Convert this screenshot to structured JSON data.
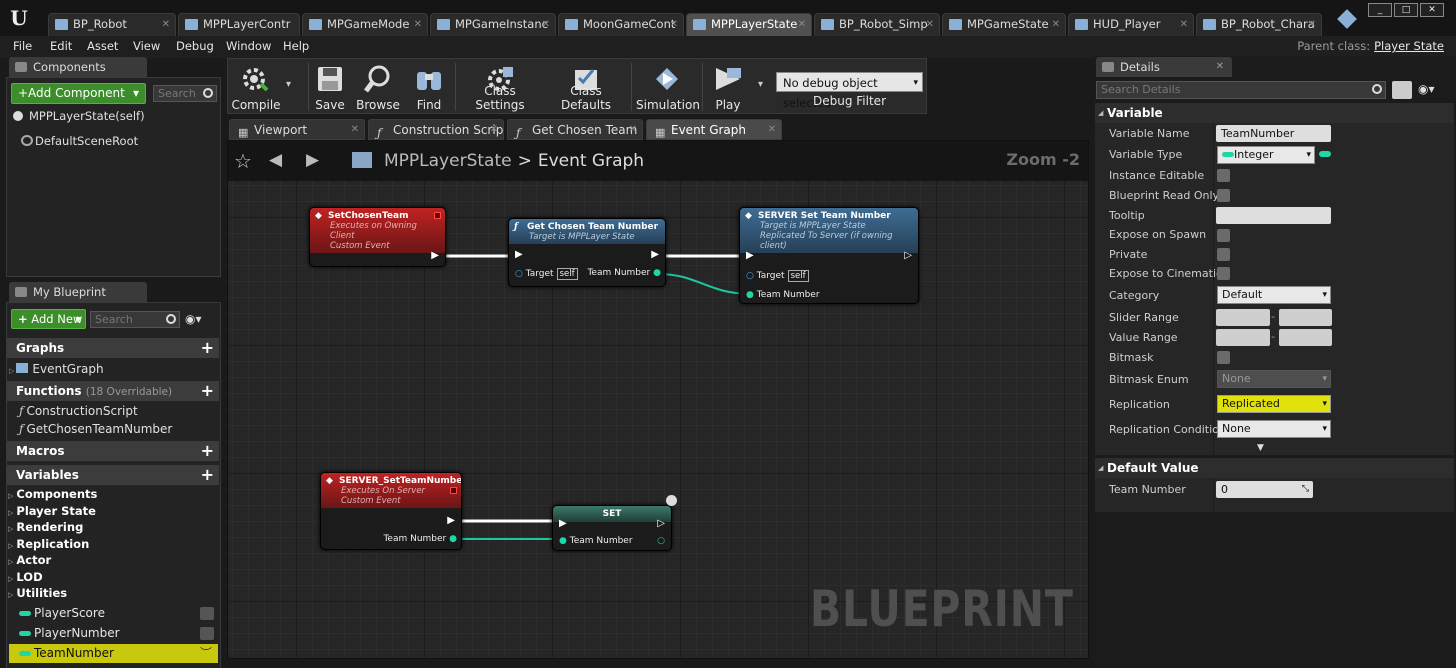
{
  "tabs": [
    {
      "label": "BP_Robot"
    },
    {
      "label": "MPPLayerContr"
    },
    {
      "label": "MPGameMode"
    },
    {
      "label": "MPGameInstanc"
    },
    {
      "label": "MoonGameCont"
    },
    {
      "label": "MPPLayerState"
    },
    {
      "label": "BP_Robot_Simp"
    },
    {
      "label": "MPGameState"
    },
    {
      "label": "HUD_Player"
    },
    {
      "label": "BP_Robot_Chara"
    }
  ],
  "menu": [
    "File",
    "Edit",
    "Asset",
    "View",
    "Debug",
    "Window",
    "Help"
  ],
  "parent_class": {
    "label": "Parent class:",
    "value": "Player State"
  },
  "components": {
    "tab": "Components",
    "add_button": "+Add Component",
    "search_placeholder": "Search",
    "items": [
      "MPPLayerState(self)",
      "DefaultSceneRoot"
    ]
  },
  "my_blueprint": {
    "tab": "My Blueprint",
    "add_button": "Add New",
    "search_placeholder": "Search",
    "graphs_label": "Graphs",
    "event_graph": "EventGraph",
    "functions_label": "Functions",
    "functions_count": "(18 Overridable)",
    "functions": [
      "ConstructionScript",
      "GetChosenTeamNumber"
    ],
    "macros_label": "Macros",
    "variables_label": "Variables",
    "categories": [
      "Components",
      "Player State",
      "Rendering",
      "Replication",
      "Actor",
      "LOD",
      "Utilities"
    ],
    "variables": [
      "PlayerScore",
      "PlayerNumber",
      "TeamNumber"
    ]
  },
  "toolbar": {
    "compile": "Compile",
    "save": "Save",
    "browse": "Browse",
    "find": "Find",
    "class_settings": "Class Settings",
    "class_defaults": "Class Defaults",
    "simulation": "Simulation",
    "play": "Play",
    "debug_object": "No debug object selected",
    "debug_filter": "Debug Filter"
  },
  "graph_tabs": [
    "Viewport",
    "Construction Scrip",
    "Get Chosen Team I",
    "Event Graph"
  ],
  "graph": {
    "breadcrumb_root": "MPPLayerState",
    "breadcrumb_sep": ">",
    "breadcrumb_current": "Event Graph",
    "zoom": "Zoom -2",
    "watermark": "BLUEPRINT",
    "nodes": {
      "set_chosen_team": {
        "title": "SetChosenTeam",
        "sub1": "Executes on Owning Client",
        "sub2": "Custom Event"
      },
      "get_chosen": {
        "title": "Get Chosen Team Number",
        "sub1": "Target is MPPLayer State",
        "target": "Target",
        "self": "self",
        "out": "Team Number"
      },
      "server_set": {
        "title": "SERVER Set Team Number",
        "sub1": "Target is MPPLayer State",
        "sub2": "Replicated To Server (if owning client)",
        "target": "Target",
        "self": "self",
        "in": "Team Number"
      },
      "server_event": {
        "title": "SERVER_SetTeamNumber",
        "sub1": "Executes On Server",
        "sub2": "Custom Event",
        "out": "Team Number"
      },
      "set": {
        "title": "SET",
        "in": "Team Number"
      }
    }
  },
  "details": {
    "tab": "Details",
    "search_placeholder": "Search Details",
    "variable_section": "Variable",
    "rows": {
      "name_label": "Variable Name",
      "name_value": "TeamNumber",
      "type_label": "Variable Type",
      "type_value": "Integer",
      "instance_editable": "Instance Editable",
      "bp_read_only": "Blueprint Read Only",
      "tooltip": "Tooltip",
      "expose_spawn": "Expose on Spawn",
      "private": "Private",
      "expose_cinematics": "Expose to Cinematics",
      "category_label": "Category",
      "category_value": "Default",
      "slider_range": "Slider Range",
      "value_range": "Value Range",
      "bitmask": "Bitmask",
      "bitmask_enum_label": "Bitmask Enum",
      "bitmask_enum_value": "None",
      "replication_label": "Replication",
      "replication_value": "Replicated",
      "rep_condition_label": "Replication Condition",
      "rep_condition_value": "None"
    },
    "default_section": "Default Value",
    "default_label": "Team Number",
    "default_value": "0"
  },
  "colors": {
    "accent_yellow": "#e1e10c",
    "int_pin": "#1ed6a6",
    "event_red": "#c02323",
    "function_blue": "#3f6d94",
    "add_green": "#3b8e2a"
  }
}
